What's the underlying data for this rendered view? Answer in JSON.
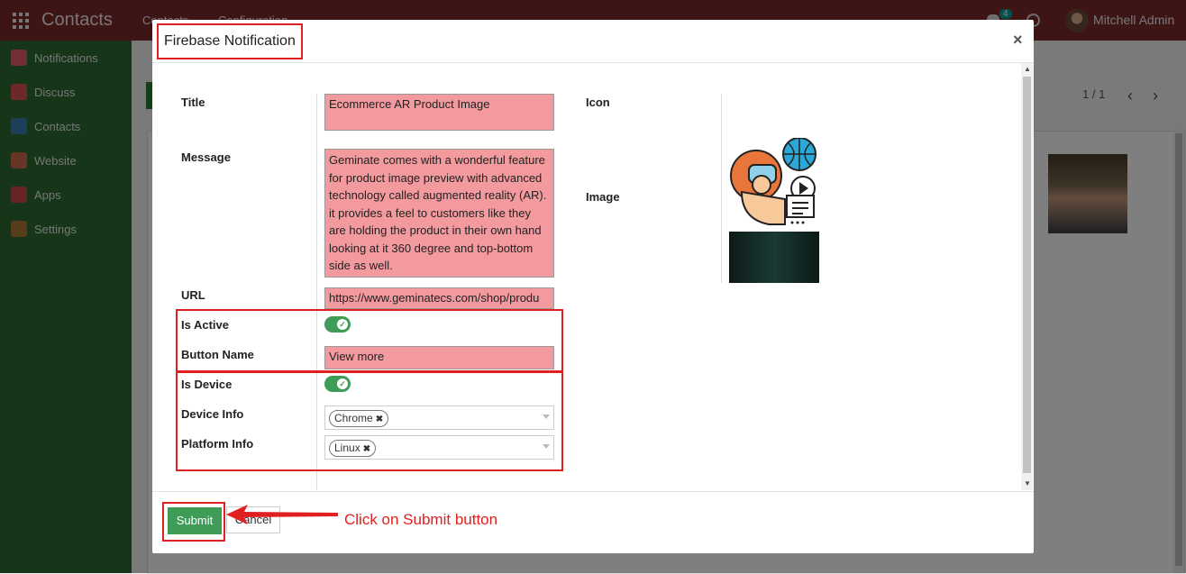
{
  "topbar": {
    "app_title": "Contacts",
    "menu": [
      "Contacts",
      "Configuration"
    ],
    "chat_badge": "4",
    "user_name": "Mitchell Admin"
  },
  "sidebar": {
    "items": [
      {
        "label": "Notifications",
        "color": "#e85d6b"
      },
      {
        "label": "Discuss",
        "color": "#d9534f"
      },
      {
        "label": "Contacts",
        "color": "#3a7fb5"
      },
      {
        "label": "Website",
        "color": "#cf6b4a"
      },
      {
        "label": "Apps",
        "color": "#d14a4a"
      },
      {
        "label": "Settings",
        "color": "#b07a3a"
      }
    ]
  },
  "background": {
    "pager": "1 / 1"
  },
  "modal": {
    "title": "Firebase Notification",
    "close_symbol": "×",
    "fields": {
      "title_label": "Title",
      "title_value": "Ecommerce AR Product Image",
      "message_label": "Message",
      "message_value": "Geminate comes with a wonderful feature for product image preview with advanced technology called augmented reality (AR). it provides a feel to customers like they are holding the product in their own hand looking at it 360 degree and top-bottom side as well.",
      "url_label": "URL",
      "url_value": "https://www.geminatecs.com/shop/produ",
      "is_active_label": "Is Active",
      "is_active": true,
      "button_name_label": "Button Name",
      "button_name_value": "View more",
      "is_device_label": "Is Device",
      "is_device": true,
      "device_info_label": "Device Info",
      "device_info_tag": "Chrome",
      "platform_info_label": "Platform Info",
      "platform_info_tag": "Linux",
      "icon_label": "Icon",
      "image_label": "Image"
    },
    "footer": {
      "submit_label": "Submit",
      "cancel_label": "Cancel"
    }
  },
  "annotation": {
    "text": "Click on Submit button",
    "color": "#e02020"
  }
}
